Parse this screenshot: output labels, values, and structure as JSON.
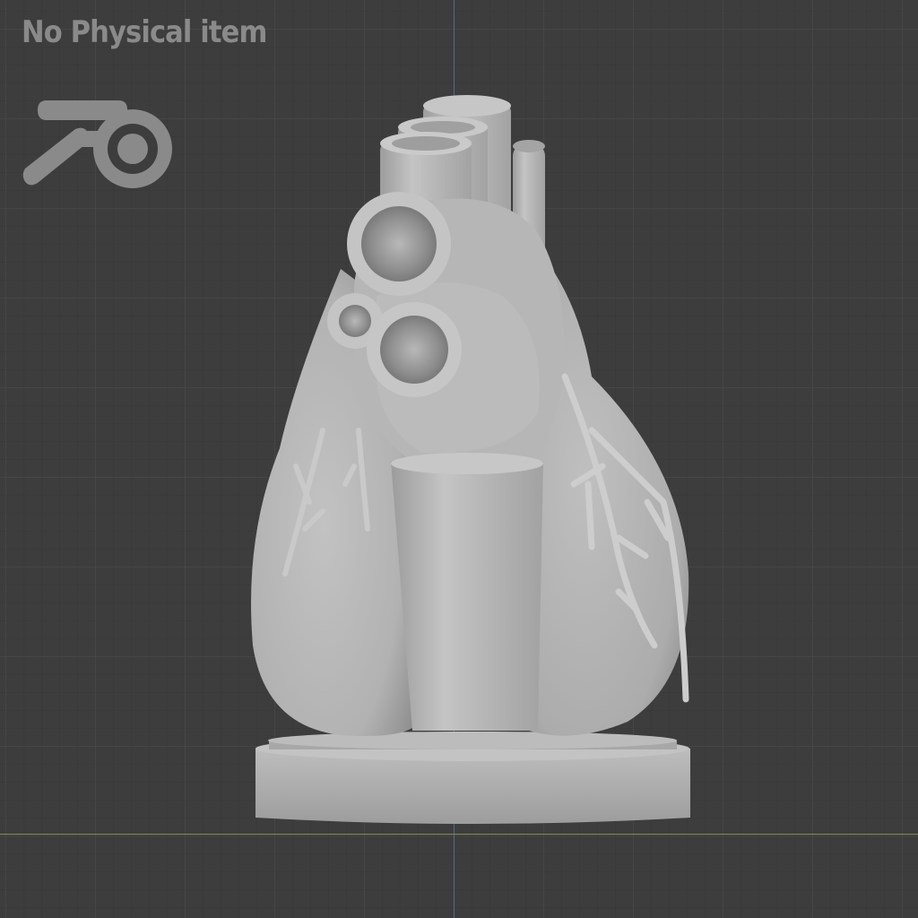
{
  "viewport": {
    "watermark": "No Physical item",
    "logo_icon": "blender-logo-icon",
    "model_icon": "heart-model-icon",
    "colors": {
      "background": "#3d3d3d",
      "grid_major": "#464646",
      "grid_minor": "#3a3a3a",
      "axis_y": "#4f6a93",
      "axis_x": "#7d8f4a",
      "model": "#b2b2b2",
      "watermark": "#8a8a8a"
    }
  }
}
